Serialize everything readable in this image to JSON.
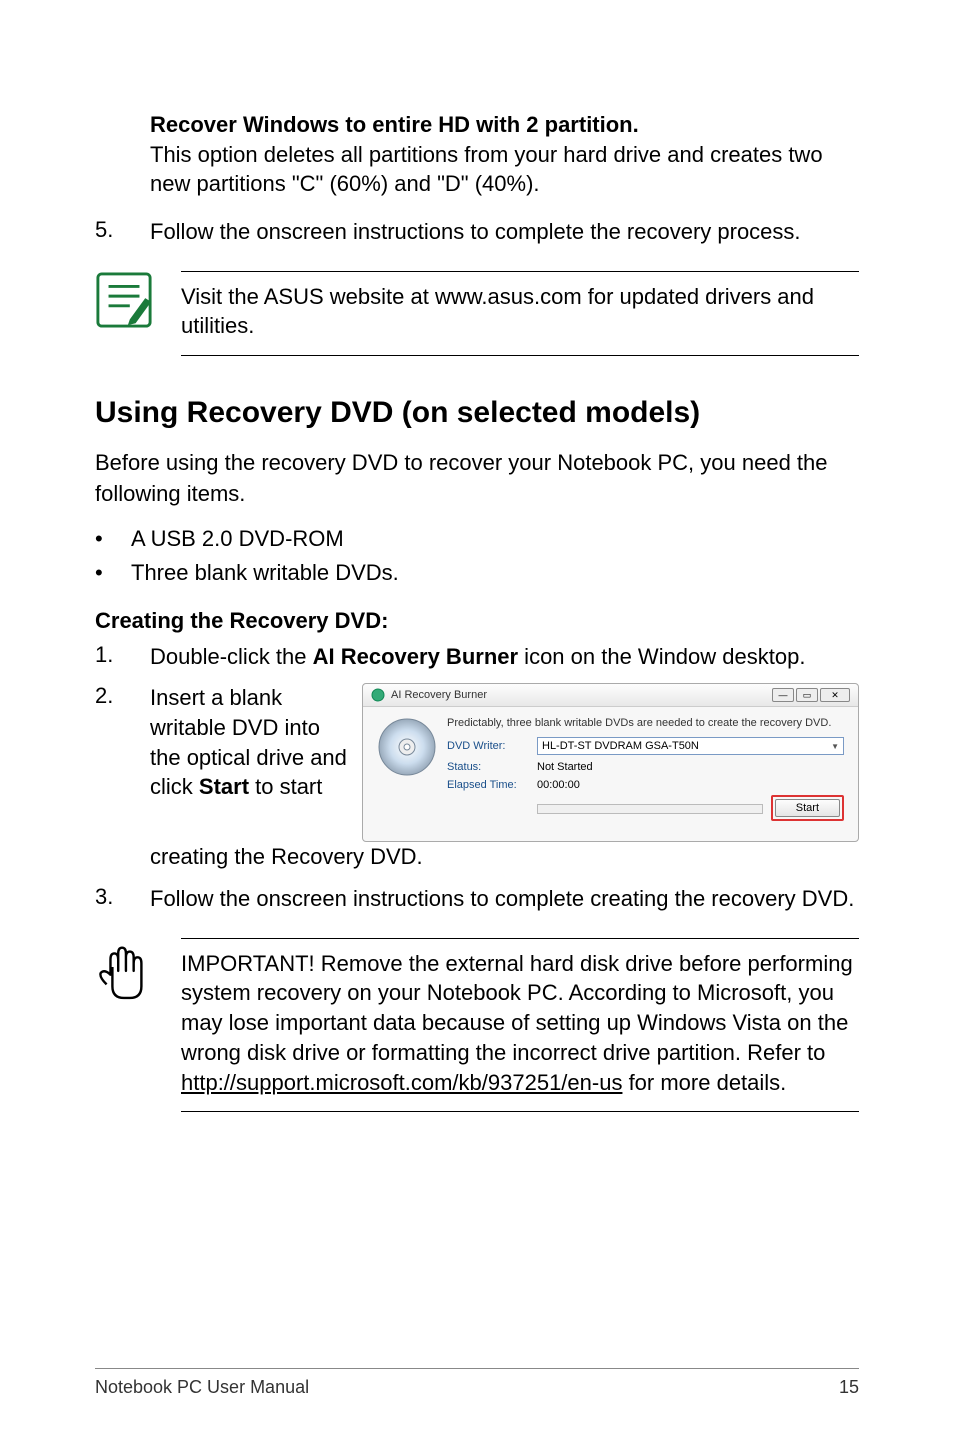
{
  "section4": {
    "heading": "Recover Windows to entire HD with 2 partition.",
    "body": "This option deletes all partitions from your hard drive and creates two new partitions \"C\" (60%) and \"D\" (40%)."
  },
  "step5": {
    "num": "5.",
    "text": "Follow the onscreen instructions to complete the recovery process."
  },
  "note1": "Visit the ASUS website at www.asus.com for updated drivers and utilities.",
  "h2": "Using Recovery DVD (on selected models)",
  "intro": "Before using the recovery DVD to recover your Notebook PC, you need the following items.",
  "bullets": [
    "A USB 2.0 DVD-ROM",
    "Three blank writable DVDs."
  ],
  "subhead": "Creating the Recovery DVD:",
  "step1": {
    "num": "1.",
    "pre": "Double-click the ",
    "bold": "AI Recovery Burner",
    "post": " icon on the Window desktop."
  },
  "step2": {
    "num": "2.",
    "pre": "Insert a blank writable DVD into the optical drive and click ",
    "bold": "Start",
    "post": " to start creating the Recovery DVD."
  },
  "screenshot": {
    "title": "AI Recovery Burner",
    "predict": "Predictably, three blank writable DVDs are needed to create the recovery DVD.",
    "rows": {
      "writer_label": "DVD Writer:",
      "writer_value": "HL-DT-ST DVDRAM GSA-T50N",
      "status_label": "Status:",
      "status_value": "Not Started",
      "time_label": "Elapsed Time:",
      "time_value": "00:00:00"
    },
    "start": "Start"
  },
  "step3": {
    "num": "3.",
    "text": "Follow the onscreen instructions to complete creating the recovery DVD."
  },
  "important": {
    "pre": "IMPORTANT! Remove the external hard disk drive before performing system recovery on your Notebook PC. According to Microsoft, you may lose important data because of setting up Windows Vista on the wrong disk drive or formatting the incorrect drive partition. Refer to ",
    "link": "http://support.microsoft.com/kb/937251/en-us",
    "post": " for more details."
  },
  "footer": {
    "left": "Notebook PC User Manual",
    "right": "15"
  }
}
